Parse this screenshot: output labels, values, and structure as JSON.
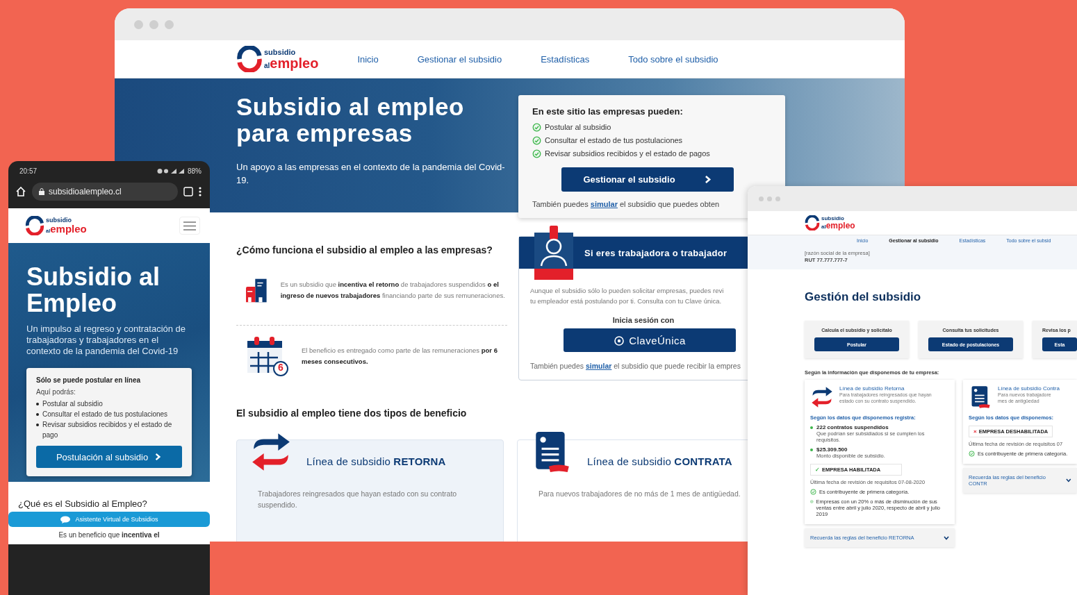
{
  "main_window": {
    "logo": {
      "top": "subsidio",
      "prefix": "al",
      "main": "empleo"
    },
    "nav_links": [
      "Inicio",
      "Gestionar el subsidio",
      "Estadísticas",
      "Todo sobre el subsidio"
    ],
    "hero": {
      "title": "Subsidio al empleo para empresas",
      "subtitle": "Un apoyo a las empresas en el contexto de la pandemia del Covid-19."
    },
    "info_card": {
      "title": "En este sitio las empresas pueden:",
      "items": [
        "Postular al subsidio",
        "Consultar el estado de tus postulaciones",
        "Revisar subsidios recibidos y el estado de pagos"
      ],
      "button": "Gestionar el subsidio",
      "note": {
        "before": "También puedes",
        "link": "simular",
        "after": "el subsidio que puedes obten"
      }
    },
    "how": {
      "title": "¿Cómo funciona el subsidio al empleo a las empresas?",
      "items": [
        {
          "kind": "buildings",
          "text": "Es un subsidio que **incentiva el retorno** de trabajadores suspendidos **o el ingreso de nuevos trabajadores** financiando parte de sus remuneraciones."
        },
        {
          "kind": "calendar",
          "badge": "6",
          "text": "El beneficio es entregado como parte de las remuneraciones **por 6 meses consecutivos.**"
        }
      ]
    },
    "worker_card": {
      "title": "Si eres trabajadora o trabajador",
      "text_lines": [
        "Aunque el subsidio sólo lo pueden solicitar empresas, puedes revi",
        "tu empleador está postulando por ti. Consulta con tu Clave única."
      ],
      "login_label": "Inicia sesión con",
      "login_button": "ClaveÚnica",
      "note": {
        "before": "También puedes",
        "link": "simular",
        "after": "el subsidio que puede recibir la empres"
      }
    },
    "benefits": {
      "title": "El subsidio al empleo tiene dos tipos de beneficio",
      "cards": [
        {
          "kind": "arrows",
          "title": "Línea de subsidio **RETORNA**",
          "text": "Trabajadores reingresados que hayan estado con su contrato suspendido."
        },
        {
          "kind": "document",
          "title": "Línea de subsidio **CONTRATA**",
          "text": "Para nuevos trabajadores de no más de 1 mes de antigüedad."
        }
      ]
    }
  },
  "phone": {
    "status_bar": {
      "time": "20:57",
      "battery": "88%"
    },
    "url": "subsidioalempleo.cl",
    "logo": {
      "top": "subsidio",
      "prefix": "al",
      "main": "empleo"
    },
    "hero": {
      "title": "Subsidio al Empleo",
      "subtitle": "Un impulso al regreso y contratación de trabajadoras y trabajadores en el contexto de la pandemia del Covid-19"
    },
    "card": {
      "title": "Sólo se puede postular en línea",
      "intro": "Aquí podrás:",
      "items": [
        "Postular al subsidio",
        "Consultar el estado de tus postulaciones",
        "Revisar subsidios recibidos y el estado de pago"
      ],
      "button": "Postulación al subsidio"
    },
    "section_title": "¿Qué es el Subsidio al Empleo?",
    "chat_bar": "Asistente Virtual de Subsidios",
    "teaser": "Es un beneficio que **incentiva el**"
  },
  "dashboard_window": {
    "logo": {
      "top": "subsidio",
      "prefix": "al",
      "main": "empleo"
    },
    "nav_links": [
      {
        "label": "Inicio",
        "selected": false
      },
      {
        "label": "Gestionar al subsidio",
        "selected": true
      },
      {
        "label": "Estadísticas",
        "selected": false
      },
      {
        "label": "Todo sobre el subsid",
        "selected": false
      }
    ],
    "company": {
      "name": "[razón social de la empresa]",
      "rut": "RUT 77.777.777-7"
    },
    "title": "Gestión del subsidio",
    "actions": [
      {
        "label": "Calcula el subsidio y solicítalo",
        "button": "Postular"
      },
      {
        "label": "Consulta tus solicitudes",
        "button": "Estado de postulaciones"
      },
      {
        "label": "Revisa los p",
        "button": "Esta"
      }
    ],
    "intro": "Según la información que disponemos de tu empresa:",
    "lines": [
      {
        "kind": "arrows",
        "title": "Línea de subsidio Retorna",
        "description_lines": [
          "Para trabajadores reingresados que hayan",
          "estado con su contrato suspendido."
        ],
        "data_label": "Según los datos que disponemos registra:",
        "figures": [
          {
            "value": "222 contratos suspendidos",
            "caption": "Que podrían ser subsidiados si se cumplen los requisitos."
          },
          {
            "value": "$25.309.500",
            "caption": "Monto disponible de subsidio."
          }
        ],
        "status": {
          "enabled": true,
          "mark": "✓",
          "label": "EMPRESA HABILITADA"
        },
        "review_date": "Última fecha de revisión de requisitos 07-08-2020",
        "requirements": [
          "Es contribuyente de primera categoría.",
          "Empresas con un 20% o más de disminución de sus ventas entre abril y julio 2020, respecto de abril y julio 2019"
        ],
        "rules_link": "Recuerda las reglas del beneficio RETORNA"
      },
      {
        "kind": "document",
        "title": "Línea de subsidio Contra",
        "description_lines": [
          "Para nuevos trabajadore",
          "mes de antigüedad"
        ],
        "data_label": "Según los datos que disponemos:",
        "status": {
          "enabled": false,
          "mark": "×",
          "label": "EMPRESA DESHABILITADA"
        },
        "review_date": "Última fecha de revisión de requisitos 07",
        "requirements": [
          "Es contribuyente de primera categoría."
        ],
        "rules_link": "Recuerda las reglas del beneficio CONTR"
      }
    ]
  }
}
